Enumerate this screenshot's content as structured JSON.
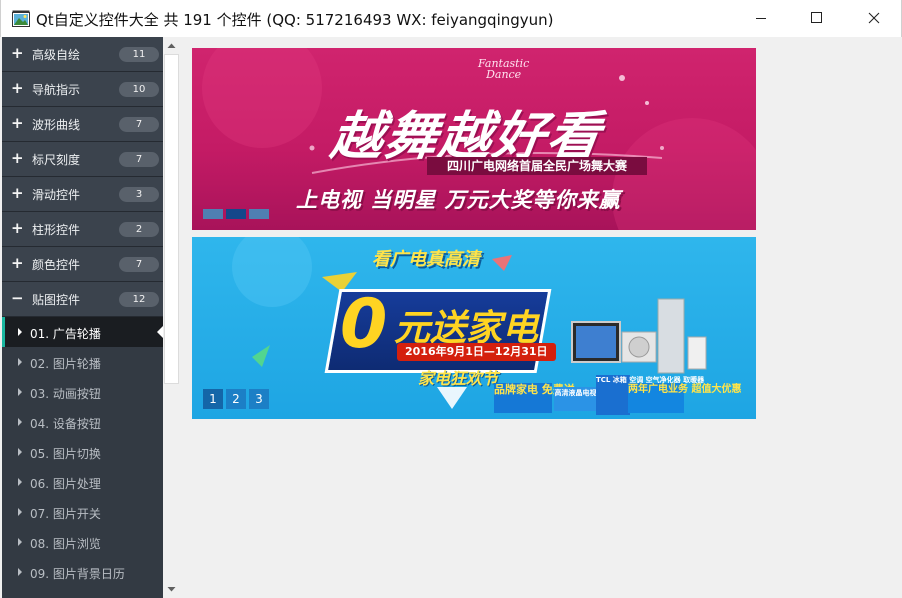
{
  "window": {
    "title": "Qt自定义控件大全 共 191 个控件 (QQ: 517216493 WX: feiyangqingyun)",
    "icon": "app-window-icon",
    "minimize_icon": "minimize-icon",
    "maximize_icon": "maximize-icon",
    "close_icon": "close-icon"
  },
  "sidebar": {
    "groups": [
      {
        "sign": "+",
        "label": "高级自绘",
        "count": "11"
      },
      {
        "sign": "+",
        "label": "导航指示",
        "count": "10"
      },
      {
        "sign": "+",
        "label": "波形曲线",
        "count": "7"
      },
      {
        "sign": "+",
        "label": "标尺刻度",
        "count": "7"
      },
      {
        "sign": "+",
        "label": "滑动控件",
        "count": "3"
      },
      {
        "sign": "+",
        "label": "柱形控件",
        "count": "2"
      },
      {
        "sign": "+",
        "label": "颜色控件",
        "count": "7"
      },
      {
        "sign": "−",
        "label": "贴图控件",
        "count": "12"
      }
    ],
    "items": [
      {
        "label": "01. 广告轮播",
        "active": true
      },
      {
        "label": "02. 图片轮播"
      },
      {
        "label": "03. 动画按钮"
      },
      {
        "label": "04. 设备按钮"
      },
      {
        "label": "05. 图片切换"
      },
      {
        "label": "06. 图片处理"
      },
      {
        "label": "07. 图片开关"
      },
      {
        "label": "08. 图片浏览"
      },
      {
        "label": "09. 图片背景日历"
      }
    ],
    "accent_color": "#1ab7a0"
  },
  "banner1": {
    "script_line1": "Fantastic",
    "script_line2": "Dance",
    "title": "越舞越好看",
    "subtitle": "四川广电网络首届全民广场舞大赛",
    "slogan": "上电视  当明星  万元大奖等你来赢"
  },
  "banner2": {
    "top": "看广电真高清",
    "zero": "0",
    "main": "元送家电",
    "date": "2016年9月1日—12月31日",
    "fest": "家电狂欢节",
    "tag1": "品牌家电 免费送",
    "tag2": "高清液晶电视机",
    "tag3": "TCL 冰箱 空调 空气净化器 取暖器",
    "tag4": "两年广电业务 超值大优惠",
    "pages": [
      "1",
      "2",
      "3"
    ]
  }
}
